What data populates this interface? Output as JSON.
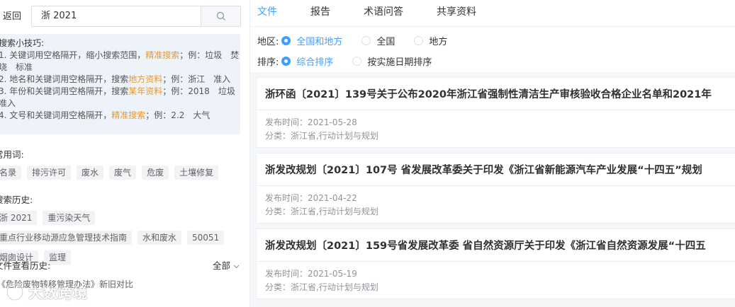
{
  "left": {
    "back_label": "返回",
    "search_value": "浙 2021",
    "tips": {
      "title": "搜索小技巧:",
      "items": [
        {
          "prefix": "1. 关键词用空格隔开，缩小搜索范围，",
          "hl": "精准搜索",
          "suffix": "；例：垃圾　焚烧　标准"
        },
        {
          "prefix": "2. 地名和关键词用空格隔开，搜索",
          "hl": "地方资料",
          "suffix": "；例：浙江　准入"
        },
        {
          "prefix": "3. 年份和关键词用空格隔开，搜索",
          "hl": "某年资料",
          "suffix": "；例：2018　垃圾　准入"
        },
        {
          "prefix": "4. 文号和关键词用空格隔开，",
          "hl": "精准搜索",
          "suffix": "；例：2.2　大气"
        }
      ]
    },
    "common_title": "常用词:",
    "common_words": [
      "名录",
      "排污许可",
      "废水",
      "废气",
      "危废",
      "土壤修复"
    ],
    "history_title": "搜索历史:",
    "history": [
      "浙 2021",
      "重污染天气",
      "重点行业移动源应急管理技术指南",
      "水和废水",
      "50051",
      "烟囱设计",
      "监理"
    ],
    "file_history_title": "文件查看历史:",
    "all_label": "全部",
    "file_history": [
      "《危险废物转移管理办法》新旧对比"
    ],
    "watermark": "大数跨境"
  },
  "right": {
    "tabs": [
      "文件",
      "报告",
      "术语问答",
      "共享资料"
    ],
    "region_label": "地区:",
    "region_options": [
      "全国和地方",
      "全国",
      "地方"
    ],
    "sort_label": "排序:",
    "sort_options": [
      "综合排序",
      "按实施日期排序"
    ],
    "results": [
      {
        "title": "浙环函〔2021〕139号关于公布2020年浙江省强制性清洁生产审核验收合格企业名单和2021年",
        "date": "发布时间：2021-05-28",
        "category": "分类：浙江省,行动计划与规划"
      },
      {
        "title": "浙发改规划〔2021〕107号 省发展改革委关于印发《浙江省新能源汽车产业发展“十四五”规划",
        "date": "发布时间：2021-04-22",
        "category": "分类：浙江省,行动计划与规划"
      },
      {
        "title": "浙发改规划〔2021〕159号省发展改革委 省自然资源厅关于印发《浙江省自然资源发展“十四五",
        "date": "发布时间：2021-05-19",
        "category": "分类：浙江省,行动计划与规划"
      }
    ]
  },
  "colors": {
    "accent": "#409eff",
    "highlight": "#e59a2c",
    "tips_bg": "#eef3fa"
  }
}
